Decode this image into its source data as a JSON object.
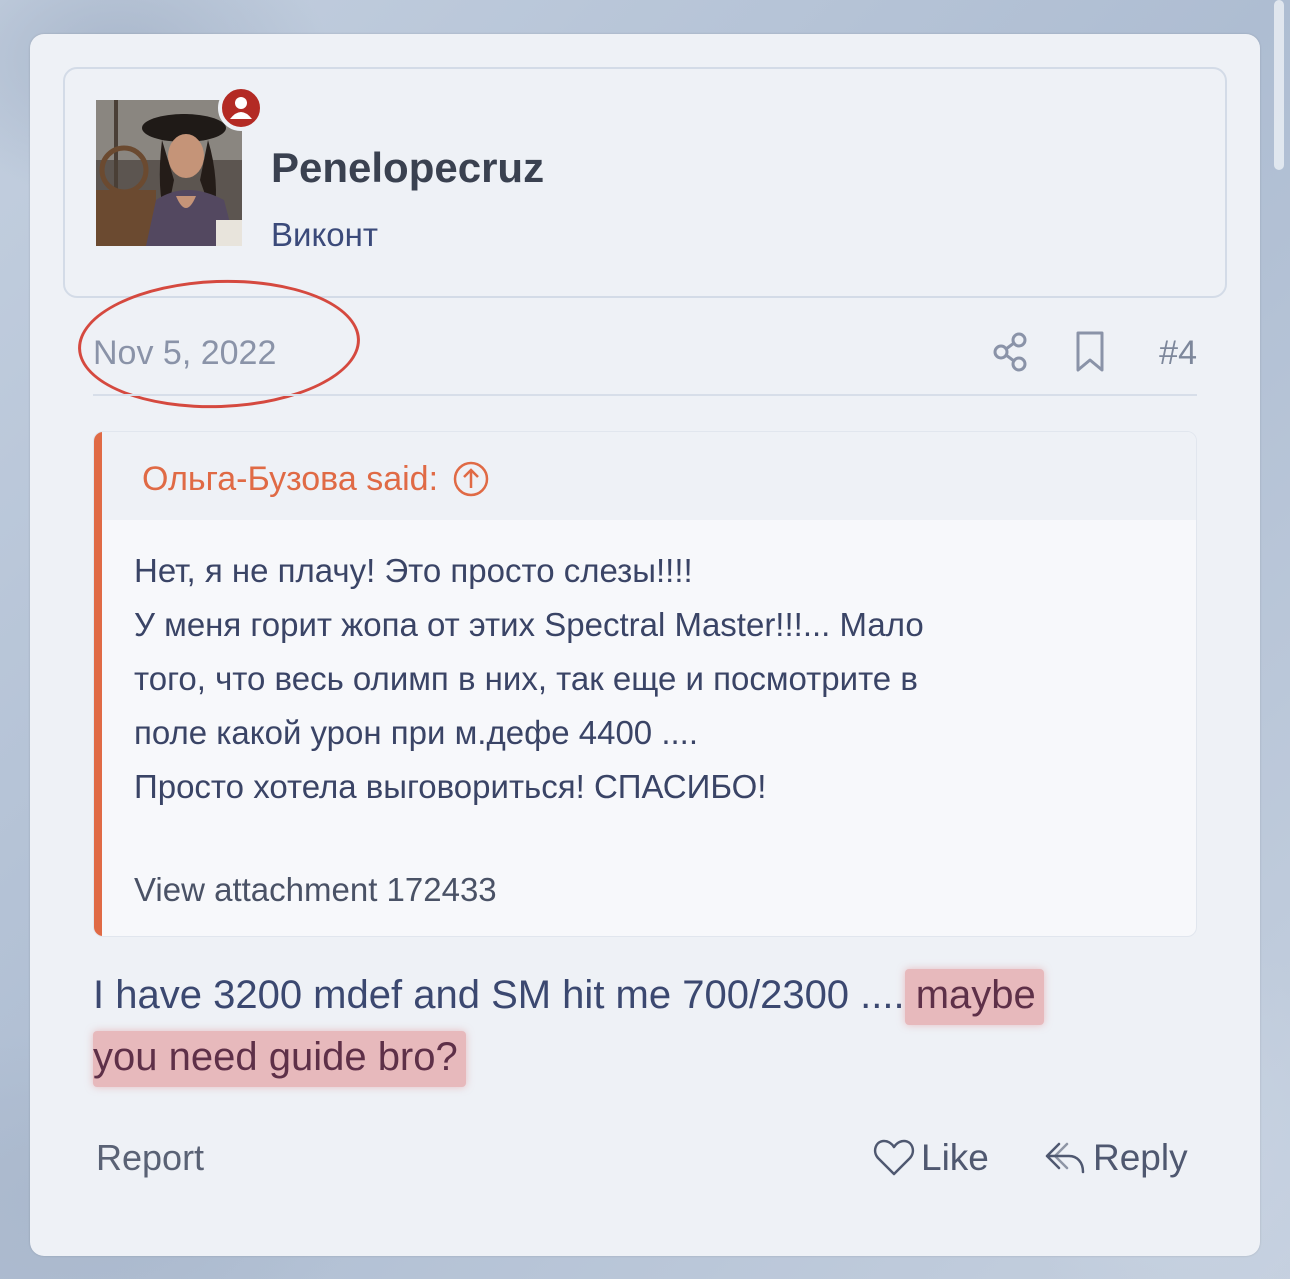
{
  "post": {
    "author": {
      "username": "Penelopecruz",
      "title": "Виконт",
      "avatar_alt": "avatar-photo",
      "badge_color": "#b32a24"
    },
    "date": "Nov 5, 2022",
    "post_number": "#4",
    "quote": {
      "author_line": "Ольга-Бузова said:",
      "lines": [
        "Нет, я не плачу! Это просто слезы!!!!",
        "У меня горит жопа от этих Spectral Master!!!... Мало",
        "того, что весь олимп в них, так еще и посмотрите в",
        "поле какой урон при м.дефе 4400 ....",
        "Просто хотела выговориться! СПАСИБО!"
      ],
      "attachment": "View attachment 172433",
      "accent_color": "#e06a45"
    },
    "message": {
      "plain": "I have 3200 mdef and SM hit me 700/2300 ....",
      "highlighted_1": " maybe",
      "highlighted_2": "you need guide bro?"
    },
    "actions": {
      "report": "Report",
      "like": "Like",
      "reply": "Reply"
    }
  },
  "annotation_color": "#d5493f",
  "highlight_color": "#e28a8c"
}
